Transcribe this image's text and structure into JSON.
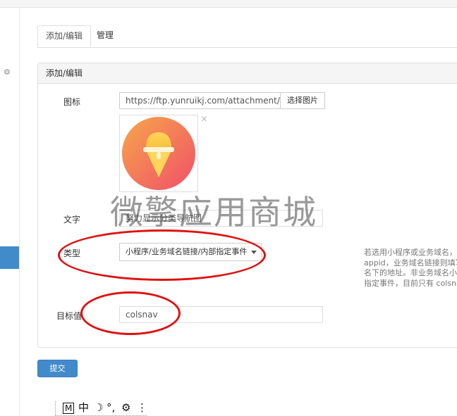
{
  "tabs": [
    {
      "label": "添加/编辑"
    },
    {
      "label": "管理"
    }
  ],
  "panel": {
    "heading": "添加/编辑"
  },
  "form": {
    "icon": {
      "label": "图标",
      "value": "https://ftp.yunruikj.com/attachment/vder",
      "button": "选择图片",
      "remove": "×"
    },
    "text": {
      "label": "文字",
      "value": "努力显示分类导航图"
    },
    "type": {
      "label": "类型",
      "selected": "小程序/业务域名链接/内部指定事件",
      "help": [
        "若选用小程序或业务域名，则",
        "appid，业务域名链接则填写",
        "名下的地址。非业务域名小程",
        "指定事件，目前只有 colsnav"
      ]
    },
    "target": {
      "label": "目标值",
      "value": "colsnav"
    }
  },
  "submit_label": "提交",
  "watermark": "微擎应用商城",
  "ime": {
    "items": [
      "M",
      "中",
      "☽",
      "°,",
      "⚙",
      "⋮"
    ]
  },
  "colors": {
    "primary": "#428bca",
    "annotation": "#e01010"
  }
}
